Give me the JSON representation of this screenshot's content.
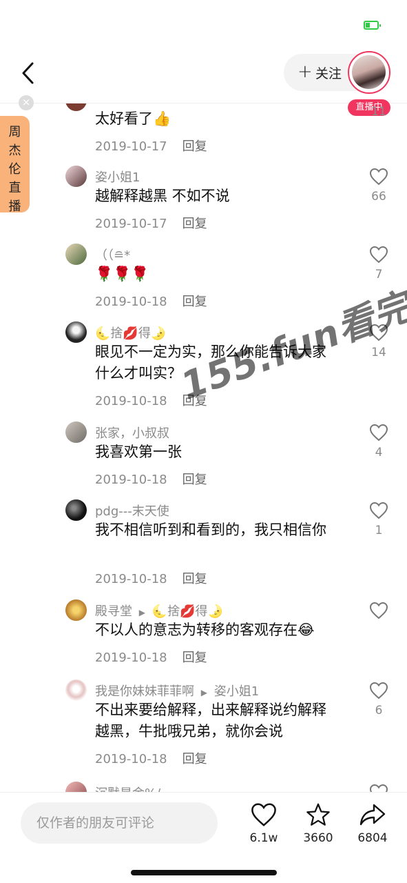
{
  "status": {
    "battery_color": "#2ecc40"
  },
  "header": {
    "follow_label": "关注",
    "live_badge": "直播中",
    "accent_color": "#f0365f"
  },
  "side_panel": {
    "label": [
      "周",
      "杰",
      "伦",
      "直",
      "播"
    ]
  },
  "comments": [
    {
      "name": "",
      "text": "太好看了👍",
      "date": "2019-10-17",
      "reply": "回复",
      "likes": "11"
    },
    {
      "name": "姿小姐1",
      "text": "越解释越黑 不如不说",
      "date": "2019-10-17",
      "reply": "回复",
      "likes": "66"
    },
    {
      "name": "（（≘*",
      "text": "🌹🌹🌹",
      "date": "2019-10-18",
      "reply": "回复",
      "likes": "7"
    },
    {
      "name": "🌜捨💋得🌛",
      "text": "眼见不一定为实，那么你能告诉大家什么才叫实？",
      "date": "2019-10-18",
      "reply": "回复",
      "likes": "14"
    },
    {
      "name": "张家，小叔叔",
      "text": "我喜欢第一张",
      "date": "2019-10-18",
      "reply": "回复",
      "likes": "4"
    },
    {
      "name": "pdg---末天使",
      "text": "我不相信听到和看到的，我只相信你",
      "date": "2019-10-18",
      "reply": "回复",
      "likes": "1"
    },
    {
      "name": "殿寻堂",
      "reply_to": "🌜捨💋得🌛",
      "text": "不以人的意志为转移的客观存在😂",
      "date": "2019-10-18",
      "reply": "回复",
      "likes": ""
    },
    {
      "name": "我是你妹妹菲菲啊",
      "reply_to": "姿小姐1",
      "text": "不出来要给解释，出来解释说约解释越黑，牛批哦兄弟，就你会说",
      "date": "2019-10-18",
      "reply": "回复",
      "likes": "6"
    },
    {
      "name": "沉默是金%/",
      "text": "",
      "date": "",
      "reply": "",
      "likes": ""
    }
  ],
  "watermark": "155.fun看完整版",
  "bottom": {
    "input_placeholder": "仅作者的朋友可评论",
    "likes": "6.1w",
    "favorites": "3660",
    "shares": "6804"
  }
}
